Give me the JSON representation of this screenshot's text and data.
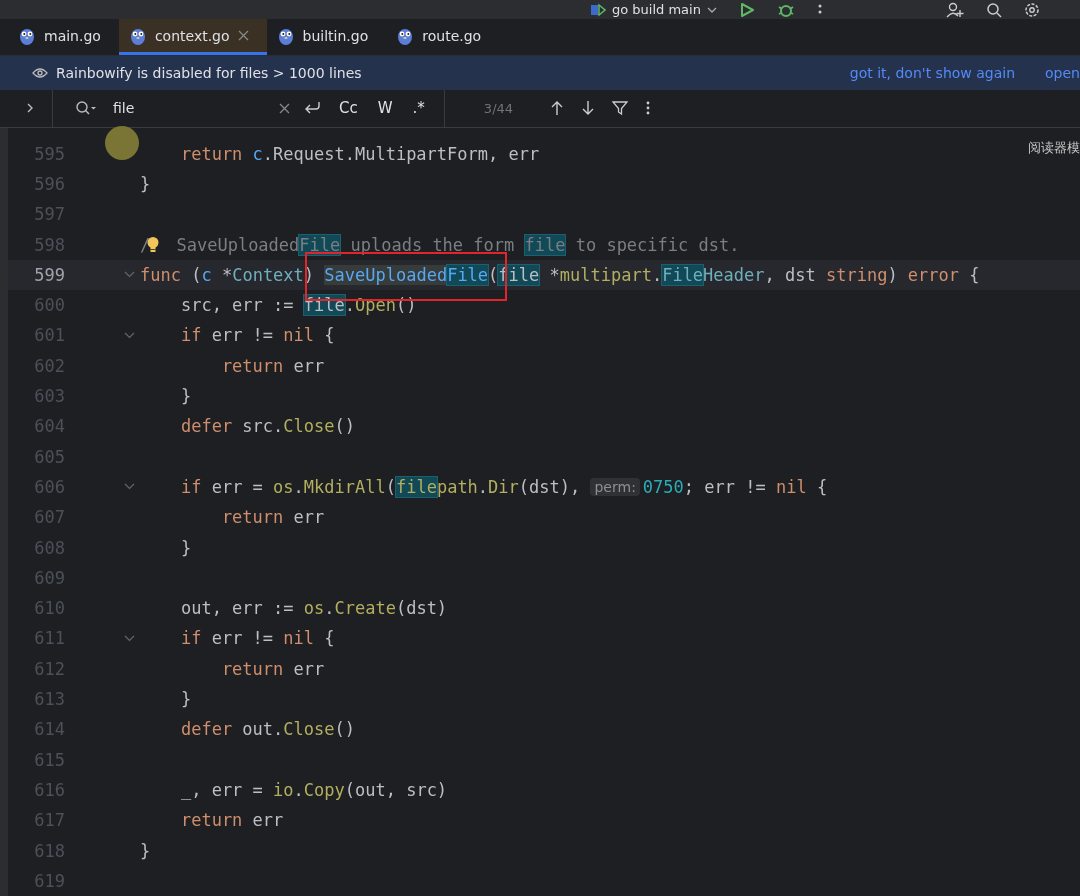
{
  "toolbar": {
    "run_config": "go build main"
  },
  "tabs": [
    {
      "label": "main.go",
      "selected": false,
      "closable": false
    },
    {
      "label": "context.go",
      "selected": true,
      "closable": true
    },
    {
      "label": "builtin.go",
      "selected": false,
      "closable": false
    },
    {
      "label": "route.go",
      "selected": false,
      "closable": false
    }
  ],
  "banner": {
    "message": "Rainbowify is disabled for files > 1000 lines",
    "actions": [
      "got it, don't show again",
      "open"
    ]
  },
  "search": {
    "query": "file",
    "toggles": [
      "Cc",
      "W",
      ".*"
    ],
    "count": "3/44"
  },
  "overlay_text": "阅读器模",
  "lines": [
    {
      "number": "595",
      "fold": false,
      "current": false,
      "tokens": [
        {
          "text": "    return ",
          "kind": "kw"
        },
        {
          "text": "c",
          "kind": "param"
        },
        {
          "text": ".Request.MultipartForm, err",
          "kind": "plain"
        }
      ]
    },
    {
      "number": "596",
      "fold": false,
      "current": false,
      "tokens": [
        {
          "text": "}",
          "kind": "plain"
        }
      ]
    },
    {
      "number": "597",
      "fold": false,
      "current": false
    },
    {
      "number": "598",
      "fold": false,
      "current": false,
      "bulb": true,
      "tokens": [
        {
          "text": "/",
          "kind": "comment"
        },
        {
          "text": " SaveUploaded",
          "kind": "comment"
        },
        {
          "text": "File",
          "kind": "comment",
          "match": true
        },
        {
          "text": " uploads the form ",
          "kind": "comment"
        },
        {
          "text": "file",
          "kind": "comment",
          "match": true
        },
        {
          "text": " to specific dst.",
          "kind": "comment"
        }
      ]
    },
    {
      "number": "599",
      "fold": true,
      "current": true,
      "tokens": [
        {
          "text": "func",
          "kind": "kw"
        },
        {
          "text": " (",
          "kind": "plain"
        },
        {
          "text": "c",
          "kind": "param"
        },
        {
          "text": " *",
          "kind": "plain"
        },
        {
          "text": "Context",
          "kind": "type"
        },
        {
          "text": ") ",
          "kind": "plain"
        },
        {
          "text": "SaveUploaded",
          "kind": "fn",
          "usage": true
        },
        {
          "text": "File",
          "kind": "fn",
          "match": true
        },
        {
          "text": "(",
          "kind": "plain"
        },
        {
          "text": "file",
          "kind": "plain",
          "match": true
        },
        {
          "text": " *",
          "kind": "plain"
        },
        {
          "text": "multipart",
          "kind": "pkg"
        },
        {
          "text": ".",
          "kind": "plain"
        },
        {
          "text": "File",
          "kind": "type",
          "match": true
        },
        {
          "text": "Header",
          "kind": "type"
        },
        {
          "text": ", dst ",
          "kind": "plain"
        },
        {
          "text": "string",
          "kind": "kw"
        },
        {
          "text": ") ",
          "kind": "plain"
        },
        {
          "text": "error",
          "kind": "kw"
        },
        {
          "text": " {",
          "kind": "plain"
        }
      ]
    },
    {
      "number": "600",
      "fold": false,
      "current": false,
      "tokens": [
        {
          "text": "    src, err := ",
          "kind": "plain"
        },
        {
          "text": "file",
          "kind": "plain",
          "match": true
        },
        {
          "text": ".",
          "kind": "plain"
        },
        {
          "text": "Open",
          "kind": "call"
        },
        {
          "text": "()",
          "kind": "plain"
        }
      ]
    },
    {
      "number": "601",
      "fold": true,
      "current": false,
      "tokens": [
        {
          "text": "    if",
          "kind": "kw"
        },
        {
          "text": " err != ",
          "kind": "plain"
        },
        {
          "text": "nil",
          "kind": "kw"
        },
        {
          "text": " {",
          "kind": "plain"
        }
      ]
    },
    {
      "number": "602",
      "fold": false,
      "current": false,
      "tokens": [
        {
          "text": "        return",
          "kind": "kw"
        },
        {
          "text": " err",
          "kind": "plain"
        }
      ]
    },
    {
      "number": "603",
      "fold": false,
      "current": false,
      "tokens": [
        {
          "text": "    }",
          "kind": "plain"
        }
      ]
    },
    {
      "number": "604",
      "fold": false,
      "current": false,
      "tokens": [
        {
          "text": "    defer",
          "kind": "kw"
        },
        {
          "text": " src.",
          "kind": "plain"
        },
        {
          "text": "Close",
          "kind": "call"
        },
        {
          "text": "()",
          "kind": "plain"
        }
      ]
    },
    {
      "number": "605",
      "fold": false,
      "current": false
    },
    {
      "number": "606",
      "fold": true,
      "current": false,
      "tokens": [
        {
          "text": "    if",
          "kind": "kw"
        },
        {
          "text": " err = ",
          "kind": "plain"
        },
        {
          "text": "os",
          "kind": "pkg"
        },
        {
          "text": ".",
          "kind": "plain"
        },
        {
          "text": "MkdirAll",
          "kind": "call"
        },
        {
          "text": "(",
          "kind": "plain"
        },
        {
          "text": "file",
          "kind": "pkg",
          "match": true
        },
        {
          "text": "path",
          "kind": "pkg"
        },
        {
          "text": ".",
          "kind": "plain"
        },
        {
          "text": "Dir",
          "kind": "call"
        },
        {
          "text": "(dst), ",
          "kind": "plain"
        },
        {
          "text": "perm:",
          "kind": "hint"
        },
        {
          "text": "0750",
          "kind": "num"
        },
        {
          "text": "; err != ",
          "kind": "plain"
        },
        {
          "text": "nil",
          "kind": "kw"
        },
        {
          "text": " {",
          "kind": "plain"
        }
      ]
    },
    {
      "number": "607",
      "fold": false,
      "current": false,
      "tokens": [
        {
          "text": "        return",
          "kind": "kw"
        },
        {
          "text": " err",
          "kind": "plain"
        }
      ]
    },
    {
      "number": "608",
      "fold": false,
      "current": false,
      "tokens": [
        {
          "text": "    }",
          "kind": "plain"
        }
      ]
    },
    {
      "number": "609",
      "fold": false,
      "current": false
    },
    {
      "number": "610",
      "fold": false,
      "current": false,
      "tokens": [
        {
          "text": "    out, err := ",
          "kind": "plain"
        },
        {
          "text": "os",
          "kind": "pkg"
        },
        {
          "text": ".",
          "kind": "plain"
        },
        {
          "text": "Create",
          "kind": "call"
        },
        {
          "text": "(dst)",
          "kind": "plain"
        }
      ]
    },
    {
      "number": "611",
      "fold": true,
      "current": false,
      "tokens": [
        {
          "text": "    if",
          "kind": "kw"
        },
        {
          "text": " err != ",
          "kind": "plain"
        },
        {
          "text": "nil",
          "kind": "kw"
        },
        {
          "text": " {",
          "kind": "plain"
        }
      ]
    },
    {
      "number": "612",
      "fold": false,
      "current": false,
      "tokens": [
        {
          "text": "        return",
          "kind": "kw"
        },
        {
          "text": " err",
          "kind": "plain"
        }
      ]
    },
    {
      "number": "613",
      "fold": false,
      "current": false,
      "tokens": [
        {
          "text": "    }",
          "kind": "plain"
        }
      ]
    },
    {
      "number": "614",
      "fold": false,
      "current": false,
      "tokens": [
        {
          "text": "    defer",
          "kind": "kw"
        },
        {
          "text": " out.",
          "kind": "plain"
        },
        {
          "text": "Close",
          "kind": "call"
        },
        {
          "text": "()",
          "kind": "plain"
        }
      ]
    },
    {
      "number": "615",
      "fold": false,
      "current": false
    },
    {
      "number": "616",
      "fold": false,
      "current": false,
      "tokens": [
        {
          "text": "    _, err = ",
          "kind": "plain"
        },
        {
          "text": "io",
          "kind": "pkg"
        },
        {
          "text": ".",
          "kind": "plain"
        },
        {
          "text": "Copy",
          "kind": "call"
        },
        {
          "text": "(out, src)",
          "kind": "plain"
        }
      ]
    },
    {
      "number": "617",
      "fold": false,
      "current": false,
      "tokens": [
        {
          "text": "    return",
          "kind": "kw"
        },
        {
          "text": " err",
          "kind": "plain"
        }
      ]
    },
    {
      "number": "618",
      "fold": false,
      "current": false,
      "tokens": [
        {
          "text": "}",
          "kind": "plain"
        }
      ]
    },
    {
      "number": "619",
      "fold": false,
      "current": false
    }
  ]
}
